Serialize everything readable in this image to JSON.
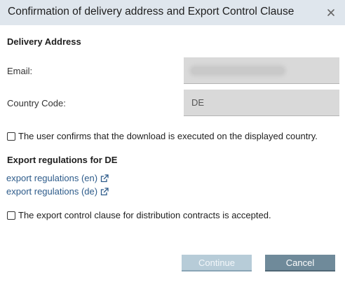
{
  "dialog": {
    "title": "Confirmation of delivery address and Export Control Clause",
    "close_icon": "close-icon"
  },
  "delivery": {
    "section_title": "Delivery Address",
    "email_label": "Email:",
    "country_label": "Country Code:",
    "country_value": "DE"
  },
  "confirm_country": {
    "label": "The user confirms that the download is executed on the displayed country.",
    "checked": false
  },
  "export": {
    "section_title": "Export regulations for DE",
    "links": [
      {
        "label": "export regulations (en)",
        "icon": "external-link-icon"
      },
      {
        "label": "export regulations (de)",
        "icon": "external-link-icon"
      }
    ]
  },
  "confirm_export": {
    "label": "The export control clause for distribution contracts is accepted.",
    "checked": false
  },
  "buttons": {
    "continue_label": "Continue",
    "cancel_label": "Cancel"
  },
  "colors": {
    "header_bg": "#dfe6ed",
    "link": "#2d5b8a",
    "continue_bg": "#b7ccd8",
    "cancel_bg": "#6f8a9a",
    "field_bg": "#d9d9d9"
  }
}
